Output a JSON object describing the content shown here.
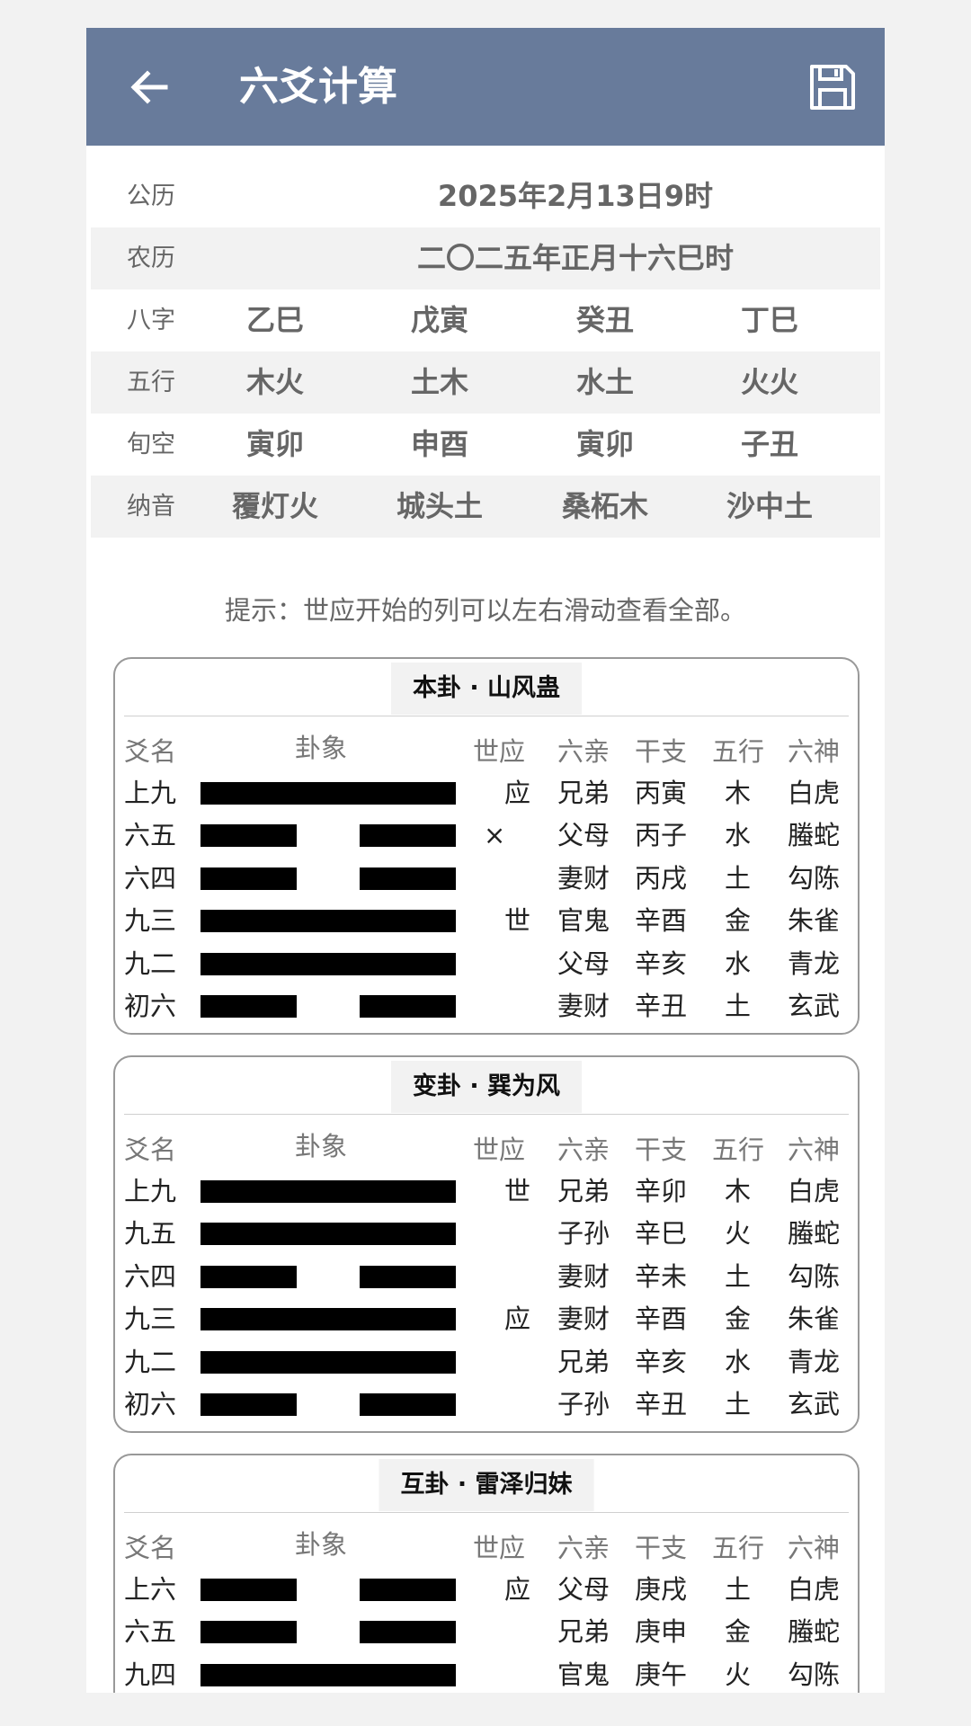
{
  "header": {
    "title": "六爻计算",
    "back_icon": "arrow-left-icon",
    "save_icon": "floppy-disk-icon"
  },
  "info": {
    "solar_label": "公历",
    "solar_value": "2025年2月13日9时",
    "lunar_label": "农历",
    "lunar_value": "二〇二五年正月十六巳时",
    "rows": [
      {
        "label": "八字",
        "values": [
          "乙巳",
          "戊寅",
          "癸丑",
          "丁巳"
        ]
      },
      {
        "label": "五行",
        "values": [
          "木火",
          "土木",
          "水土",
          "火火"
        ]
      },
      {
        "label": "旬空",
        "values": [
          "寅卯",
          "申酉",
          "寅卯",
          "子丑"
        ]
      },
      {
        "label": "纳音",
        "values": [
          "覆灯火",
          "城头土",
          "桑柘木",
          "沙中土"
        ]
      }
    ]
  },
  "hint": "提示：世应开始的列可以左右滑动查看全部。",
  "columns": [
    "爻名",
    "卦象",
    "世应",
    "六亲",
    "干支",
    "五行",
    "六神"
  ],
  "hexagrams": [
    {
      "title": "本卦 · 山风蛊",
      "lines": [
        {
          "name": "上九",
          "yin": false,
          "shiying": "应",
          "liuqin": "兄弟",
          "ganzhi": "丙寅",
          "wuxing": "木",
          "liushen": "白虎"
        },
        {
          "name": "六五",
          "yin": true,
          "mark": "×",
          "shiying": "",
          "liuqin": "父母",
          "ganzhi": "丙子",
          "wuxing": "水",
          "liushen": "螣蛇"
        },
        {
          "name": "六四",
          "yin": true,
          "shiying": "",
          "liuqin": "妻财",
          "ganzhi": "丙戌",
          "wuxing": "土",
          "liushen": "勾陈"
        },
        {
          "name": "九三",
          "yin": false,
          "shiying": "世",
          "liuqin": "官鬼",
          "ganzhi": "辛酉",
          "wuxing": "金",
          "liushen": "朱雀"
        },
        {
          "name": "九二",
          "yin": false,
          "shiying": "",
          "liuqin": "父母",
          "ganzhi": "辛亥",
          "wuxing": "水",
          "liushen": "青龙"
        },
        {
          "name": "初六",
          "yin": true,
          "shiying": "",
          "liuqin": "妻财",
          "ganzhi": "辛丑",
          "wuxing": "土",
          "liushen": "玄武"
        }
      ]
    },
    {
      "title": "变卦 · 巽为风",
      "lines": [
        {
          "name": "上九",
          "yin": false,
          "shiying": "世",
          "liuqin": "兄弟",
          "ganzhi": "辛卯",
          "wuxing": "木",
          "liushen": "白虎"
        },
        {
          "name": "九五",
          "yin": false,
          "shiying": "",
          "liuqin": "子孙",
          "ganzhi": "辛巳",
          "wuxing": "火",
          "liushen": "螣蛇"
        },
        {
          "name": "六四",
          "yin": true,
          "shiying": "",
          "liuqin": "妻财",
          "ganzhi": "辛未",
          "wuxing": "土",
          "liushen": "勾陈"
        },
        {
          "name": "九三",
          "yin": false,
          "shiying": "应",
          "liuqin": "妻财",
          "ganzhi": "辛酉",
          "wuxing": "金",
          "liushen": "朱雀"
        },
        {
          "name": "九二",
          "yin": false,
          "shiying": "",
          "liuqin": "兄弟",
          "ganzhi": "辛亥",
          "wuxing": "水",
          "liushen": "青龙"
        },
        {
          "name": "初六",
          "yin": true,
          "shiying": "",
          "liuqin": "子孙",
          "ganzhi": "辛丑",
          "wuxing": "土",
          "liushen": "玄武"
        }
      ]
    },
    {
      "title": "互卦 · 雷泽归妹",
      "lines": [
        {
          "name": "上六",
          "yin": true,
          "shiying": "应",
          "liuqin": "父母",
          "ganzhi": "庚戌",
          "wuxing": "土",
          "liushen": "白虎"
        },
        {
          "name": "六五",
          "yin": true,
          "shiying": "",
          "liuqin": "兄弟",
          "ganzhi": "庚申",
          "wuxing": "金",
          "liushen": "螣蛇"
        },
        {
          "name": "九四",
          "yin": false,
          "shiying": "",
          "liuqin": "官鬼",
          "ganzhi": "庚午",
          "wuxing": "火",
          "liushen": "勾陈"
        }
      ]
    }
  ]
}
